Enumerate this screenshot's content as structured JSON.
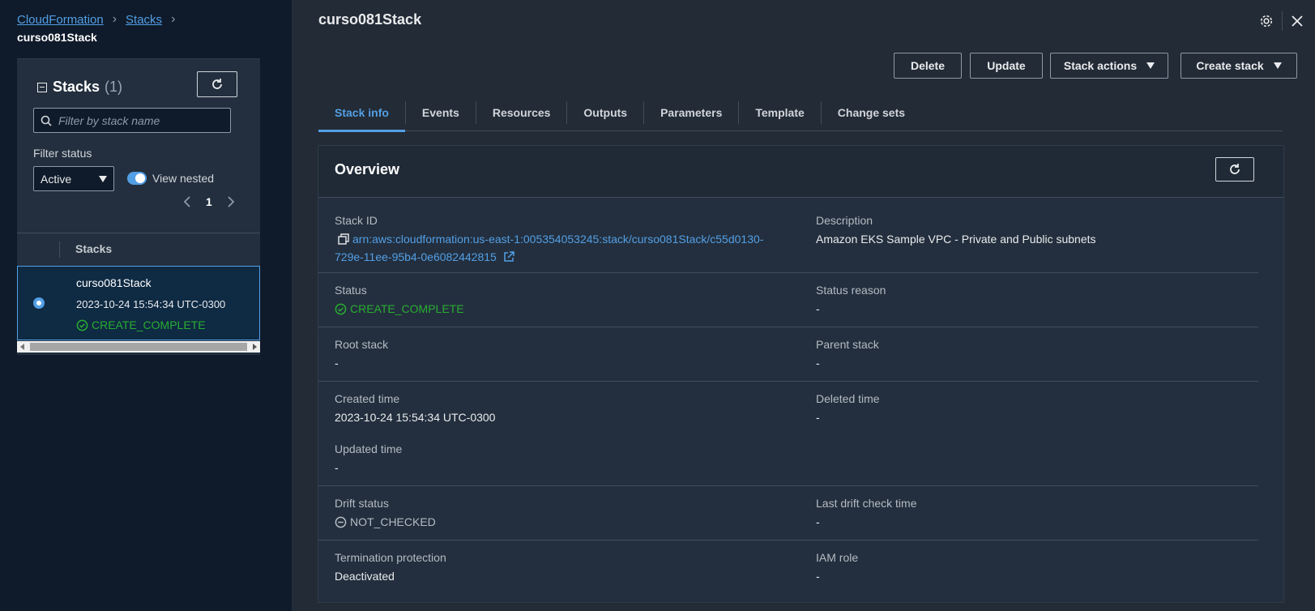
{
  "breadcrumb": {
    "items": [
      "CloudFormation",
      "Stacks"
    ],
    "current": "curso081Stack"
  },
  "stacks_panel": {
    "title": "Stacks",
    "count": "(1)",
    "search_placeholder": "Filter by stack name",
    "filter_status_label": "Filter status",
    "filter_status_value": "Active",
    "view_nested_label": "View nested",
    "view_nested_on": true,
    "page": "1",
    "column_header": "Stacks",
    "rows": [
      {
        "name": "curso081Stack",
        "created": "2023-10-24 15:54:34 UTC-0300",
        "status": "CREATE_COMPLETE",
        "selected": true
      }
    ]
  },
  "detail": {
    "title": "curso081Stack",
    "buttons": {
      "delete": "Delete",
      "update": "Update",
      "stack_actions": "Stack actions",
      "create_stack": "Create stack"
    },
    "tabs": [
      "Stack info",
      "Events",
      "Resources",
      "Outputs",
      "Parameters",
      "Template",
      "Change sets"
    ],
    "active_tab": "Stack info",
    "overview": {
      "title": "Overview",
      "stack_id_label": "Stack ID",
      "stack_id_line1": "arn:aws:cloudformation:us-east-1:005354053245:stack/curso081Stack/c55d0130-",
      "stack_id_line2": "729e-11ee-95b4-0e6082442815",
      "description_label": "Description",
      "description_value": "Amazon EKS Sample VPC - Private and Public subnets",
      "status_label": "Status",
      "status_value": "CREATE_COMPLETE",
      "status_reason_label": "Status reason",
      "status_reason_value": "-",
      "root_stack_label": "Root stack",
      "root_stack_value": "-",
      "parent_stack_label": "Parent stack",
      "parent_stack_value": "-",
      "created_time_label": "Created time",
      "created_time_value": "2023-10-24 15:54:34 UTC-0300",
      "deleted_time_label": "Deleted time",
      "deleted_time_value": "-",
      "updated_time_label": "Updated time",
      "updated_time_value": "-",
      "drift_status_label": "Drift status",
      "drift_status_value": "NOT_CHECKED",
      "last_drift_label": "Last drift check time",
      "last_drift_value": "-",
      "termination_label": "Termination protection",
      "termination_value": "Deactivated",
      "iam_role_label": "IAM role",
      "iam_role_value": "-"
    }
  },
  "colors": {
    "link": "#539fe5",
    "success": "#29ad32",
    "left_bg": "#0f1b2a",
    "right_bg": "#232b36"
  },
  "icons": [
    "refresh-icon",
    "search-icon",
    "settings-icon",
    "close-icon",
    "copy-icon",
    "external-link-icon",
    "success-icon",
    "not-checked-icon"
  ]
}
